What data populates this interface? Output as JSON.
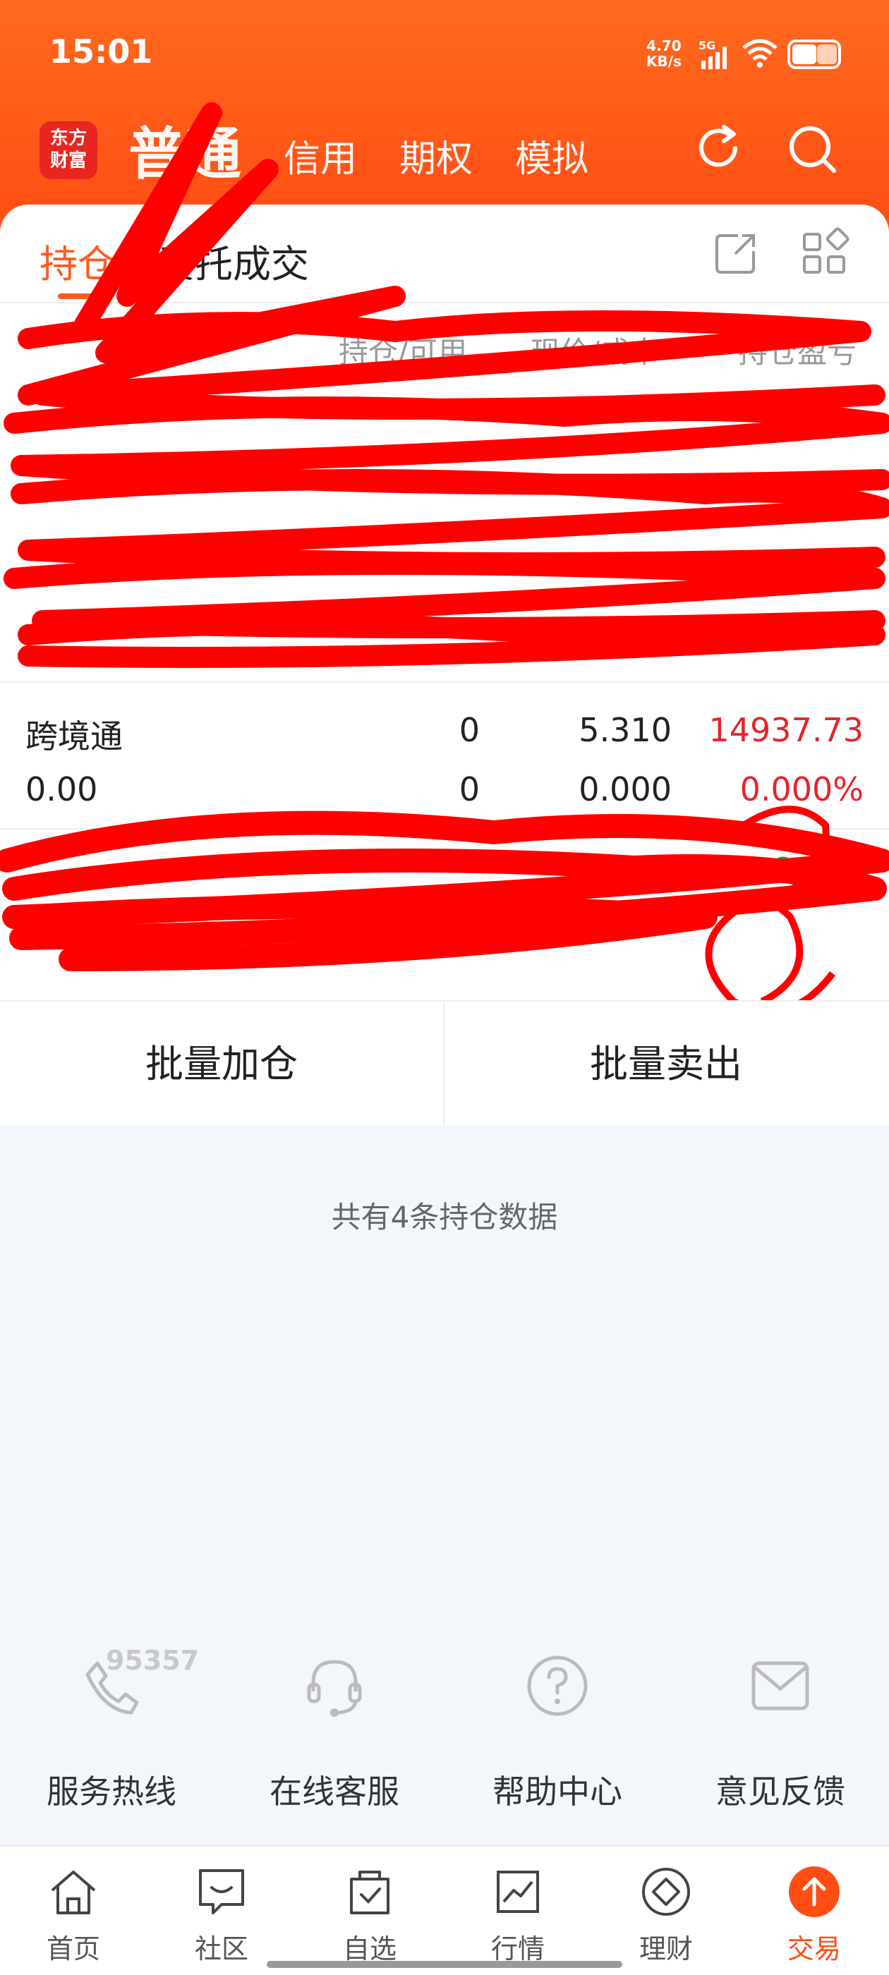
{
  "status_bar": {
    "time": "15:01",
    "net_speed_value": "4.70",
    "net_speed_unit": "KB/s",
    "signal": "5G"
  },
  "header": {
    "logo_text_line1": "东方",
    "logo_text_line2": "财富",
    "tabs": [
      "普通",
      "信用",
      "期权",
      "模拟"
    ],
    "active_tab": "普通",
    "colors": {
      "accent": "#ff4d14",
      "logo_bg": "#e8251f"
    },
    "icons": {
      "refresh": "refresh-icon",
      "search": "search-icon"
    }
  },
  "subtabs": {
    "items": [
      "持仓",
      "委托成交"
    ],
    "active": "持仓"
  },
  "table": {
    "headers": [
      "持仓/可用",
      "现价/成本",
      "持仓盈亏"
    ],
    "rows": [
      {
        "name": "跨境通",
        "sub": "0.00",
        "qty": "0",
        "avail": "0",
        "price": "5.310",
        "cost": "0.000",
        "pnl": "14937.73",
        "pnl_pct": "0.000%"
      }
    ],
    "partial_green_value": "61.91"
  },
  "batch": {
    "add": "批量加仓",
    "sell": "批量卖出"
  },
  "summary_text": "共有4条持仓数据",
  "services": {
    "hotline_number": "95357",
    "items": [
      {
        "label": "服务热线",
        "icon": "phone-icon"
      },
      {
        "label": "在线客服",
        "icon": "headset-icon"
      },
      {
        "label": "帮助中心",
        "icon": "question-icon"
      },
      {
        "label": "意见反馈",
        "icon": "mail-icon"
      }
    ]
  },
  "bottom_nav": {
    "items": [
      {
        "label": "首页",
        "icon": "home-icon"
      },
      {
        "label": "社区",
        "icon": "community-icon"
      },
      {
        "label": "自选",
        "icon": "watchlist-icon"
      },
      {
        "label": "行情",
        "icon": "chart-icon"
      },
      {
        "label": "理财",
        "icon": "wealth-icon"
      },
      {
        "label": "交易",
        "icon": "trade-icon"
      }
    ],
    "active": "交易"
  }
}
